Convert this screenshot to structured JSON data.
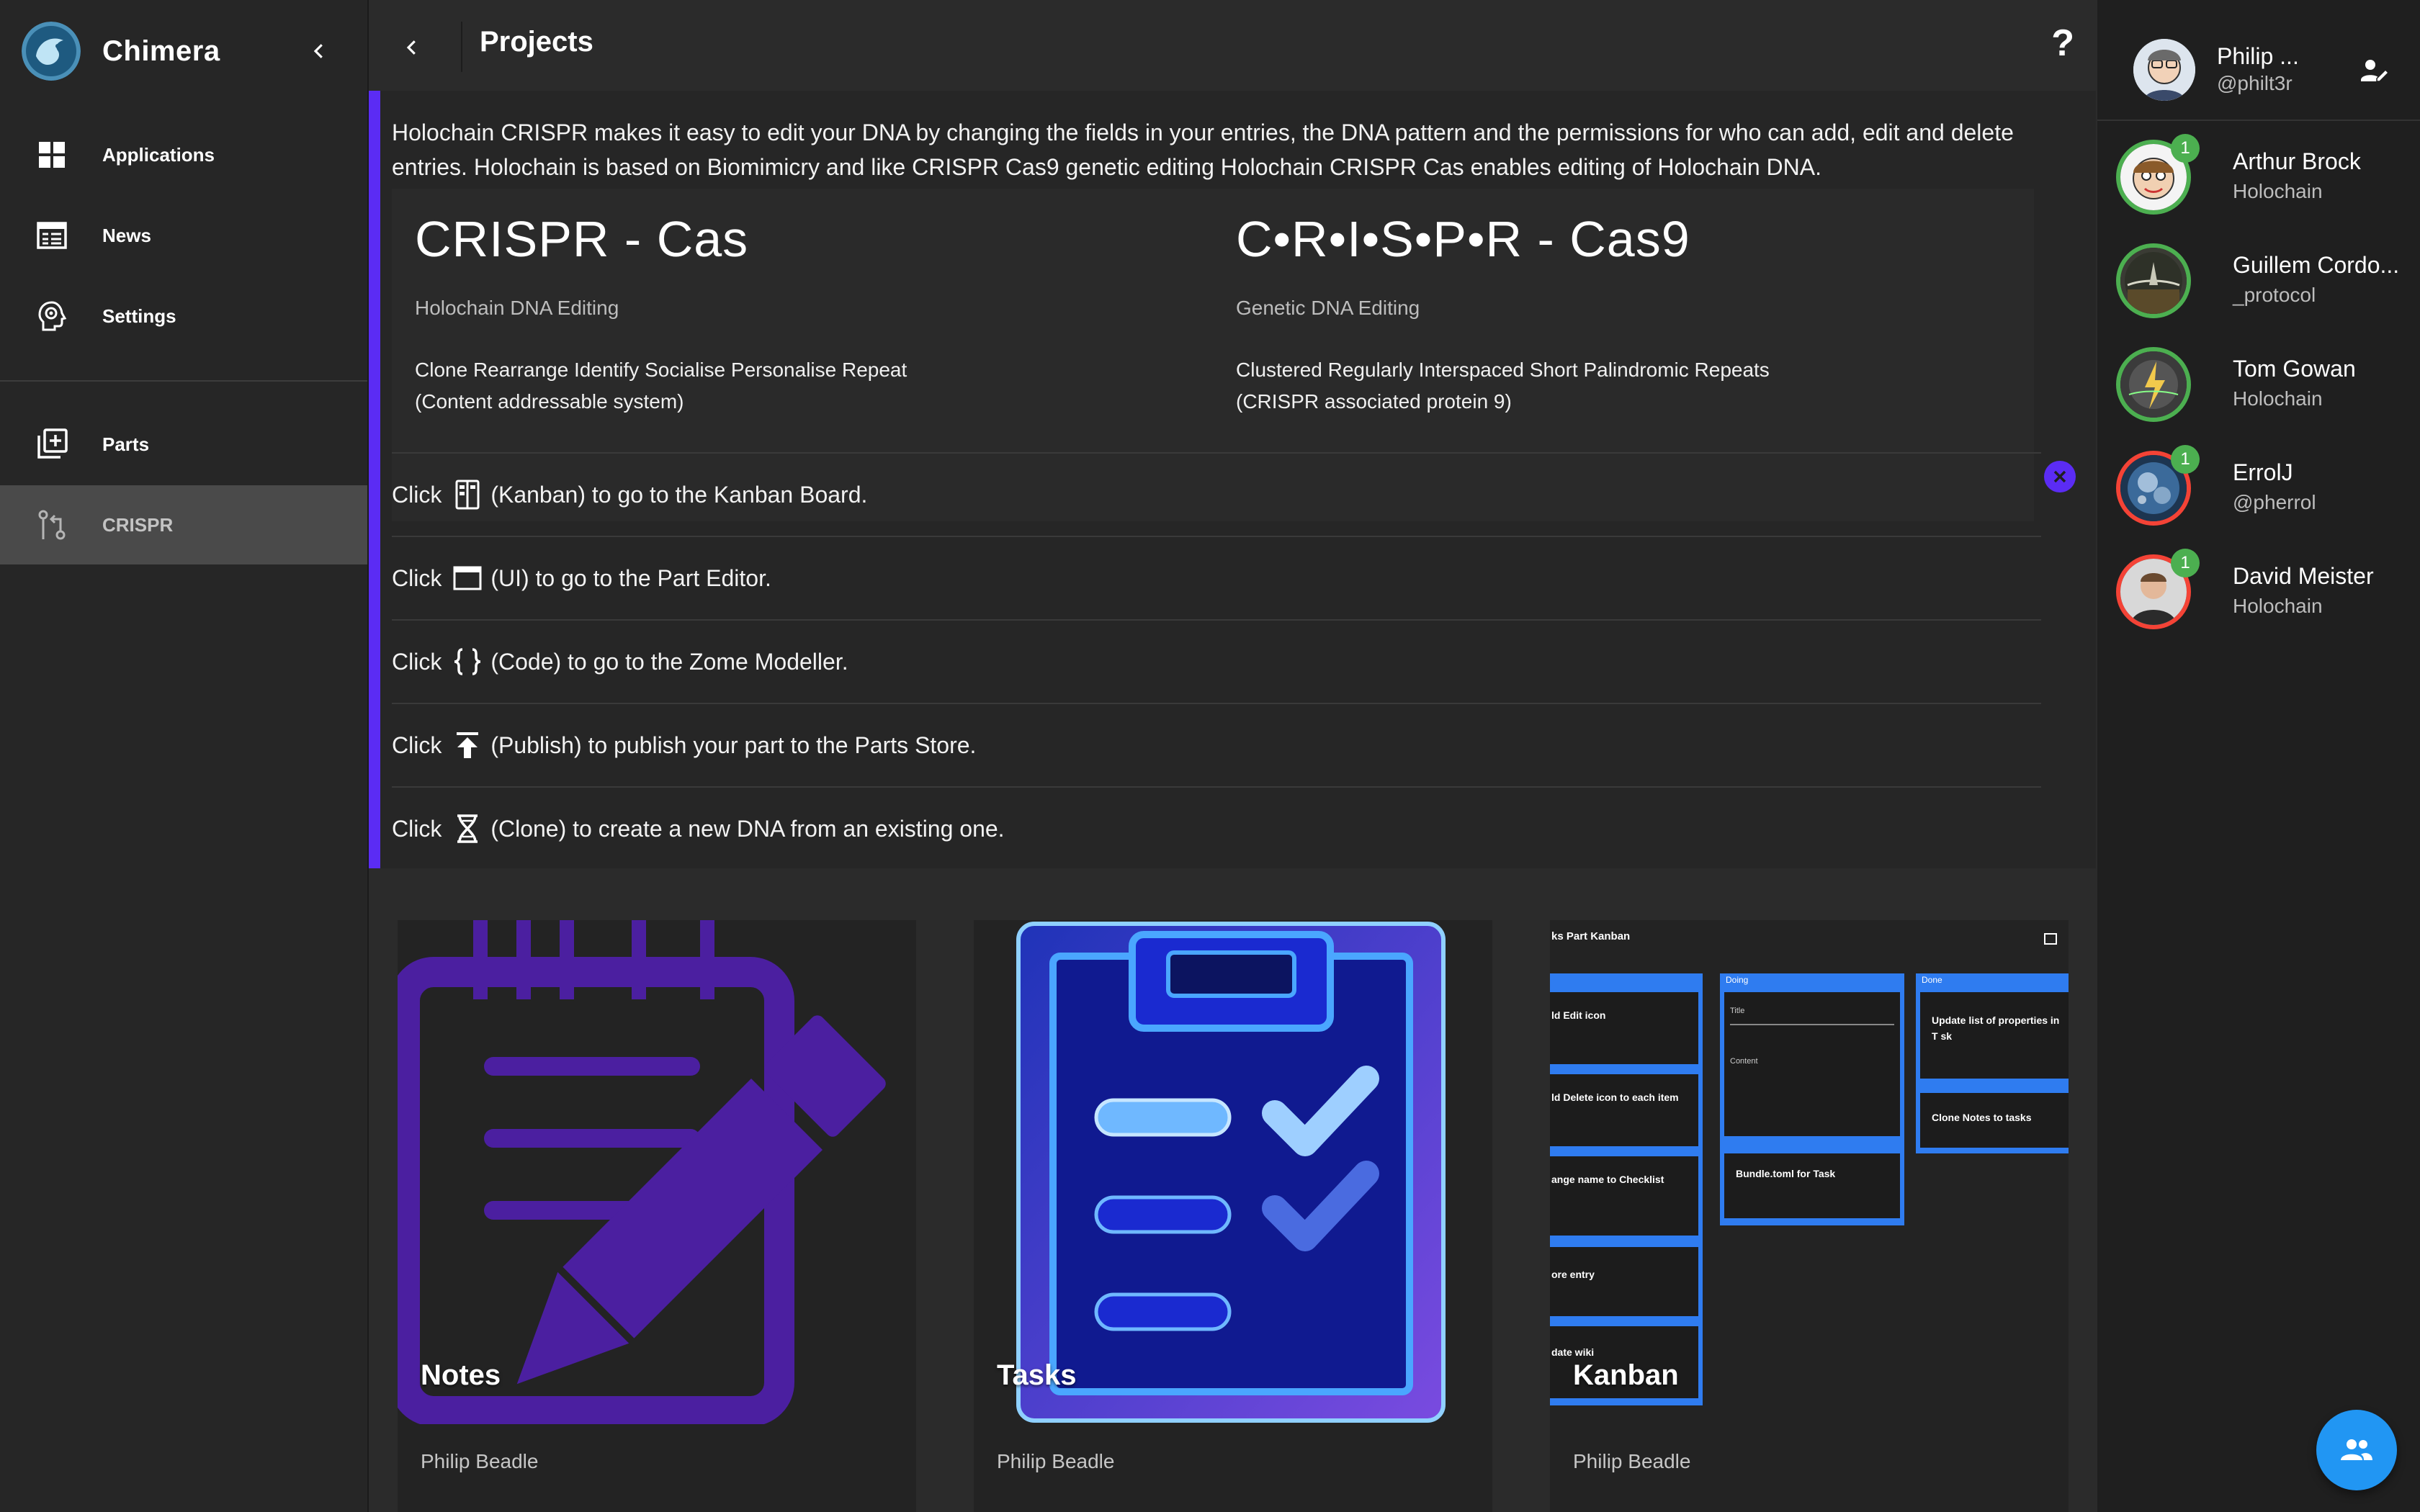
{
  "app": {
    "name": "Chimera"
  },
  "sidebar": {
    "items": [
      {
        "label": "Applications",
        "icon": "apps-grid-icon"
      },
      {
        "label": "News",
        "icon": "newspaper-icon"
      },
      {
        "label": "Settings",
        "icon": "settings-head-icon"
      },
      {
        "label": "Parts",
        "icon": "library-add-icon"
      },
      {
        "label": "CRISPR",
        "icon": "merge-icon",
        "active": true
      }
    ]
  },
  "header": {
    "title": "Projects",
    "help": "?"
  },
  "info": {
    "intro": "Holochain CRISPR makes it easy to edit your DNA by changing the fields in your entries, the DNA pattern and the permissions for who can add, edit and delete entries. Holochain is based on Biomimicry and like CRISPR Cas9 genetic editing Holochain CRISPR Cas enables editing of Holochain DNA.",
    "cards": [
      {
        "title": "CRISPR - Cas",
        "subtitle": "Holochain DNA Editing",
        "line1": "Clone Rearrange Identify Socialise Personalise Repeat",
        "line2": "(Content addressable system)"
      },
      {
        "title": "C•R•I•S•P•R - Cas9",
        "subtitle": "Genetic DNA Editing",
        "line1": "Clustered Regularly Interspaced Short Palindromic Repeats",
        "line2": "(CRISPR associated protein 9)"
      }
    ],
    "instructions": [
      {
        "pre": "Click",
        "icon": "kanban-icon",
        "post": "(Kanban) to go to the Kanban Board."
      },
      {
        "pre": "Click",
        "icon": "window-icon",
        "post": "(UI) to go to the Part Editor."
      },
      {
        "pre": "Click",
        "icon": "code-braces-icon",
        "post": "(Code) to go to the Zome Modeller."
      },
      {
        "pre": "Click",
        "icon": "publish-icon",
        "post": "(Publish) to publish your part to the Parts Store."
      },
      {
        "pre": "Click",
        "icon": "dna-icon",
        "post": "(Clone) to create a new DNA from an existing one."
      }
    ]
  },
  "gallery": [
    {
      "name": "Notes",
      "author": "Philip Beadle"
    },
    {
      "name": "Tasks",
      "author": "Philip Beadle"
    },
    {
      "name": "Kanban",
      "author": "Philip Beadle"
    }
  ],
  "kanban_preview": {
    "title": "ks Part Kanban",
    "col_doing": "Doing",
    "col_done": "Done",
    "cards_left": [
      "ld Edit icon",
      "ld Delete icon to each item",
      "ange name to Checklist",
      "ore entry",
      "date wiki"
    ],
    "form_title": "Title",
    "form_content": "Content",
    "bundle_card": "Bundle.toml for Task",
    "done_cards": [
      "Update list of properties in T sk",
      "Clone Notes to tasks"
    ]
  },
  "me": {
    "name": "Philip ...",
    "handle": "@philt3r"
  },
  "contacts": [
    {
      "name": "Arthur Brock",
      "sub": "Holochain",
      "badge": "1",
      "ring": "#4caf50"
    },
    {
      "name": "Guillem Cordo...",
      "sub": "_protocol",
      "badge": "",
      "ring": "#4caf50"
    },
    {
      "name": "Tom Gowan",
      "sub": "Holochain",
      "badge": "",
      "ring": "#4caf50"
    },
    {
      "name": "ErrolJ",
      "sub": "@pherrol",
      "badge": "1",
      "ring": "#f44336"
    },
    {
      "name": "David Meister",
      "sub": "Holochain",
      "badge": "1",
      "ring": "#f44336"
    }
  ],
  "colors": {
    "accent": "#5b2cf4",
    "fab": "#2196f3",
    "online": "#4caf50",
    "busy": "#f44336"
  }
}
